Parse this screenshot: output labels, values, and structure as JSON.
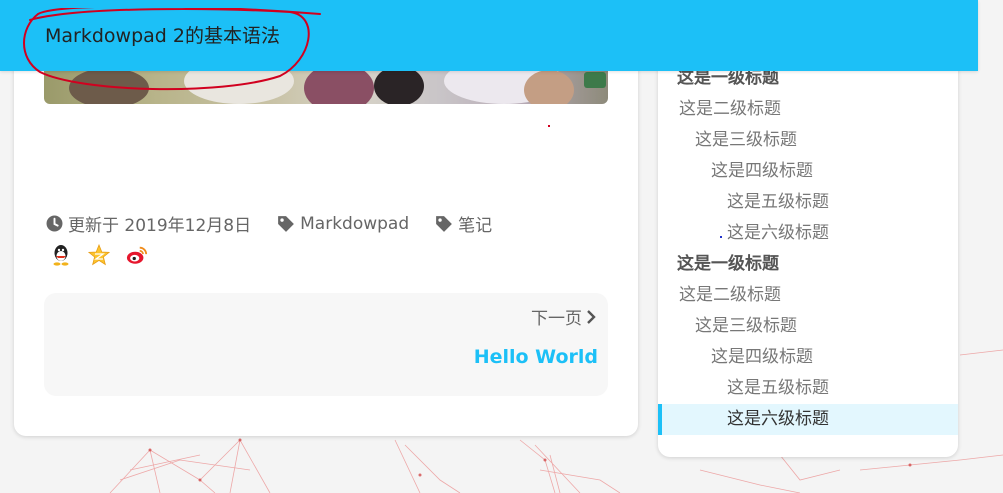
{
  "header": {
    "title": "Markdowpad 2的基本语法"
  },
  "post": {
    "updated": "更新于 2019年12月8日",
    "category": "Markdowpad",
    "tag": "笔记",
    "share": [
      "qq-icon",
      "qzone-icon",
      "weibo-icon"
    ],
    "pager": {
      "next_label": "下一页",
      "next_title": "Hello World"
    }
  },
  "toc": {
    "items": [
      {
        "label": "这是一级标题",
        "level": 1
      },
      {
        "label": "这是二级标题",
        "level": 2
      },
      {
        "label": "这是三级标题",
        "level": 3
      },
      {
        "label": "这是四级标题",
        "level": 4
      },
      {
        "label": "这是五级标题",
        "level": 5
      },
      {
        "label": "这是六级标题",
        "level": 6
      },
      {
        "label": "这是一级标题",
        "level": 1
      },
      {
        "label": "这是二级标题",
        "level": 2
      },
      {
        "label": "这是三级标题",
        "level": 3
      },
      {
        "label": "这是四级标题",
        "level": 4
      },
      {
        "label": "这是五级标题",
        "level": 5
      },
      {
        "label": "这是六级标题",
        "level": 6,
        "active": true
      }
    ]
  },
  "colors": {
    "accent": "#1cc0f7",
    "annotation": "#d1001f"
  }
}
